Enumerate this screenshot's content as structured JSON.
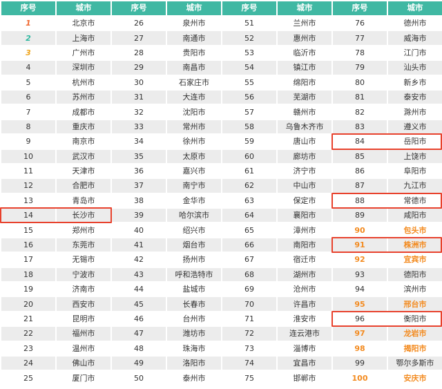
{
  "headers": [
    "序号",
    "城市",
    "序号",
    "城市",
    "序号",
    "城市",
    "序号",
    "城市"
  ],
  "cities": [
    "北京市",
    "上海市",
    "广州市",
    "深圳市",
    "杭州市",
    "苏州市",
    "成都市",
    "重庆市",
    "南京市",
    "武汉市",
    "天津市",
    "合肥市",
    "青岛市",
    "长沙市",
    "郑州市",
    "东莞市",
    "无锡市",
    "宁波市",
    "济南市",
    "西安市",
    "昆明市",
    "福州市",
    "温州市",
    "佛山市",
    "厦门市",
    "泉州市",
    "南通市",
    "贵阳市",
    "南昌市",
    "石家庄市",
    "大连市",
    "沈阳市",
    "常州市",
    "徐州市",
    "太原市",
    "嘉兴市",
    "南宁市",
    "金华市",
    "哈尔滨市",
    "绍兴市",
    "烟台市",
    "扬州市",
    "呼和浩特市",
    "盐城市",
    "长春市",
    "台州市",
    "潍坊市",
    "珠海市",
    "洛阳市",
    "泰州市",
    "兰州市",
    "惠州市",
    "临沂市",
    "镇江市",
    "绵阳市",
    "芜湖市",
    "赣州市",
    "乌鲁木齐市",
    "唐山市",
    "廊坊市",
    "济宁市",
    "中山市",
    "保定市",
    "襄阳市",
    "漳州市",
    "南阳市",
    "宿迁市",
    "湖州市",
    "沧州市",
    "许昌市",
    "淮安市",
    "连云港市",
    "淄博市",
    "宜昌市",
    "邯郸市",
    "德州市",
    "威海市",
    "江门市",
    "汕头市",
    "新乡市",
    "泰安市",
    "滁州市",
    "遵义市",
    "岳阳市",
    "上饶市",
    "阜阳市",
    "九江市",
    "常德市",
    "咸阳市",
    "包头市",
    "株洲市",
    "宜宾市",
    "德阳市",
    "滨州市",
    "邢台市",
    "衡阳市",
    "龙岩市",
    "揭阳市",
    "鄂尔多斯市",
    "安庆市"
  ],
  "medal_ranks": [
    1,
    2,
    3
  ],
  "orange_ranks": [
    90,
    91,
    92,
    95,
    97,
    98,
    100
  ],
  "highlighted_ranks": [
    14,
    84,
    88,
    91,
    96
  ],
  "colors": {
    "header_bg": "#40b8a3",
    "row_alt_bg": "#ececec",
    "highlight_border": "#e8412c",
    "orange_text": "#f38a1e",
    "rank1": "#f0682f",
    "rank2": "#2fb8a0",
    "rank3": "#f0a51c"
  }
}
